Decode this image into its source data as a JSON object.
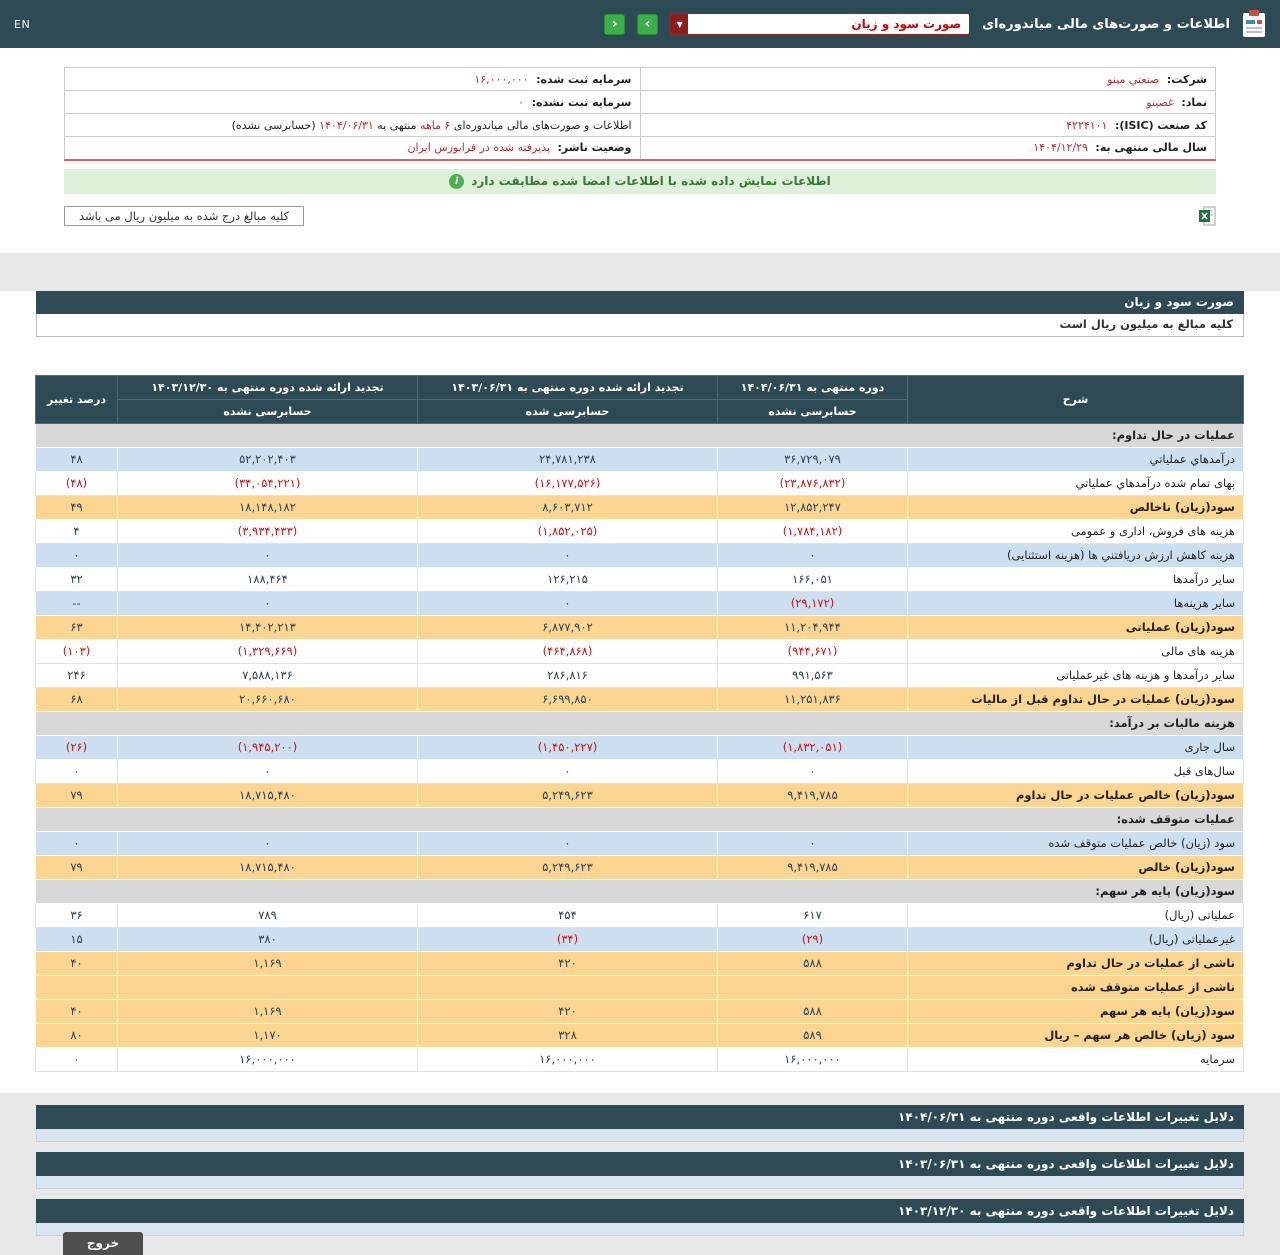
{
  "topbar": {
    "title": "اطلاعات و صورت‌های مالی میاندوره‌ای",
    "report_select": {
      "value": "صورت سود و زیان",
      "caret": "▼"
    },
    "nav_forward": "›",
    "nav_back": "‹",
    "lang_link": "EN"
  },
  "company_info": {
    "company_label": "شرکت:",
    "company_value": "صنعتي مينو",
    "symbol_label": "نماد:",
    "symbol_value": "غصينو",
    "isic_label": "کد صنعت (ISIC):",
    "isic_value": "۴۲۲۴۱۰۱",
    "fiscal_year_label": "سال مالی منتهی به:",
    "fiscal_year_value": "۱۴۰۴/۱۲/۲۹",
    "registered_capital_label": "سرمایه ثبت شده:",
    "registered_capital_value": "۱۶,۰۰۰,۰۰۰",
    "unregistered_capital_label": "سرمایه ثبت نشده:",
    "unregistered_capital_value": "۰",
    "period_line": {
      "p1": "اطلاعات و صورت‌های مالی میاندوره‌ای ",
      "p2": "۶ ماهه",
      "p3": " منتهی به ",
      "p4": "۱۴۰۴/۰۶/۳۱",
      "p5": " (حسابرسی نشده)"
    },
    "publisher_status_label": "وضعیت ناشر:",
    "publisher_status_value": "پذيرفته شده در فرابورس ايران"
  },
  "signature_banner": "اطلاعات نمایش داده شده با اطلاعات امضا شده مطابقت دارد",
  "amounts_note": "کلیه مبالغ درج شده به میلیون ریال می باشد",
  "statement": {
    "title": "صورت سود و زیان",
    "subtitle": "کلیه مبالغ به میلیون ریال است",
    "columns": {
      "desc": "شرح",
      "col1_period": "دوره منتهی به ۱۴۰۴/۰۶/۳۱",
      "col1_audit": "حسابرسی نشده",
      "col2_period": "تجدید ارائه شده دوره منتهی به ۱۴۰۳/۰۶/۳۱",
      "col2_audit": "حسابرسی شده",
      "col3_period": "تجدید ارائه شده دوره منتهی به ۱۴۰۳/۱۲/۳۰",
      "col3_audit": "حسابرسی نشده",
      "pct": "درصد تغییر"
    },
    "rows": [
      {
        "type": "section",
        "label": "عملیات در حال تداوم:",
        "style": "section"
      },
      {
        "type": "data",
        "label": "درآمدهاي عملياتي",
        "v1": "۳۶,۷۲۹,۰۷۹",
        "v2": "۲۴,۷۸۱,۲۳۸",
        "v3": "۵۲,۲۰۲,۴۰۳",
        "pct": "۴۸",
        "style": "blue"
      },
      {
        "type": "data",
        "label": "بهای تمام شده درآمدهاي عملياتي",
        "v1": "(۲۳,۸۷۶,۸۳۲)",
        "v2": "(۱۶,۱۷۷,۵۲۶)",
        "v3": "(۳۴,۰۵۴,۲۲۱)",
        "pct": "(۴۸)",
        "style": "white"
      },
      {
        "type": "data",
        "label": "سود(زیان) ناخالص",
        "v1": "۱۲,۸۵۲,۲۴۷",
        "v2": "۸,۶۰۳,۷۱۲",
        "v3": "۱۸,۱۴۸,۱۸۲",
        "pct": "۴۹",
        "style": "yellow"
      },
      {
        "type": "data",
        "label": "هزینه های فروش، اداری و عمومی",
        "v1": "(۱,۷۸۴,۱۸۲)",
        "v2": "(۱,۸۵۲,۰۲۵)",
        "v3": "(۳,۹۳۴,۴۳۳)",
        "pct": "۴",
        "style": "white"
      },
      {
        "type": "data",
        "label": "هزینه کاهش ارزش دریافتني ها (هزینه استثنایی)",
        "v1": "۰",
        "v2": "۰",
        "v3": "۰",
        "pct": "۰",
        "style": "blue"
      },
      {
        "type": "data",
        "label": "سایر درآمدها",
        "v1": "۱۶۶,۰۵۱",
        "v2": "۱۲۶,۲۱۵",
        "v3": "۱۸۸,۴۶۴",
        "pct": "۳۲",
        "style": "white"
      },
      {
        "type": "data",
        "label": "سایر هزینه‌ها",
        "v1": "(۲۹,۱۷۲)",
        "v2": "۰",
        "v3": "۰",
        "pct": "--",
        "style": "blue"
      },
      {
        "type": "data",
        "label": "سود(زیان) عملیاتی",
        "v1": "۱۱,۲۰۴,۹۴۴",
        "v2": "۶,۸۷۷,۹۰۲",
        "v3": "۱۴,۴۰۲,۲۱۳",
        "pct": "۶۳",
        "style": "yellow"
      },
      {
        "type": "data",
        "label": "هزینه های مالی",
        "v1": "(۹۴۴,۶۷۱)",
        "v2": "(۴۶۴,۸۶۸)",
        "v3": "(۱,۳۲۹,۶۶۹)",
        "pct": "(۱۰۳)",
        "style": "white"
      },
      {
        "type": "data",
        "label": "سایر درآمدها و هزینه های غیرعملیاتی",
        "v1": "۹۹۱,۵۶۳",
        "v2": "۲۸۶,۸۱۶",
        "v3": "۷,۵۸۸,۱۳۶",
        "pct": "۲۴۶",
        "style": "white"
      },
      {
        "type": "data",
        "label": "سود(زیان) عملیات در حال تداوم قبل از مالیات",
        "v1": "۱۱,۲۵۱,۸۳۶",
        "v2": "۶,۶۹۹,۸۵۰",
        "v3": "۲۰,۶۶۰,۶۸۰",
        "pct": "۶۸",
        "style": "yellow"
      },
      {
        "type": "section",
        "label": "هزینه مالیات بر درآمد:",
        "style": "section"
      },
      {
        "type": "data",
        "label": "سال جاری",
        "v1": "(۱,۸۳۲,۰۵۱)",
        "v2": "(۱,۴۵۰,۲۲۷)",
        "v3": "(۱,۹۴۵,۲۰۰)",
        "pct": "(۲۶)",
        "style": "blue"
      },
      {
        "type": "data",
        "label": "سال‌های قبل",
        "v1": "۰",
        "v2": "۰",
        "v3": "۰",
        "pct": "۰",
        "style": "white"
      },
      {
        "type": "data",
        "label": "سود(زیان) خالص عملیات در حال تداوم",
        "v1": "۹,۴۱۹,۷۸۵",
        "v2": "۵,۲۴۹,۶۲۳",
        "v3": "۱۸,۷۱۵,۴۸۰",
        "pct": "۷۹",
        "style": "yellow"
      },
      {
        "type": "section",
        "label": "عملیات متوقف شده:",
        "style": "section"
      },
      {
        "type": "data",
        "label": "سود (زیان) خالص عملیات متوقف شده",
        "v1": "۰",
        "v2": "۰",
        "v3": "۰",
        "pct": "۰",
        "style": "blue"
      },
      {
        "type": "data",
        "label": "سود(زیان) خالص",
        "v1": "۹,۴۱۹,۷۸۵",
        "v2": "۵,۲۴۹,۶۲۳",
        "v3": "۱۸,۷۱۵,۴۸۰",
        "pct": "۷۹",
        "style": "yellow"
      },
      {
        "type": "section",
        "label": "سود(زیان) پایه هر سهم:",
        "style": "section"
      },
      {
        "type": "data",
        "label": "عملیاتی (ریال)",
        "v1": "۶۱۷",
        "v2": "۴۵۴",
        "v3": "۷۸۹",
        "pct": "۳۶",
        "style": "white"
      },
      {
        "type": "data",
        "label": "غیرعملیاتی (ریال)",
        "v1": "(۲۹)",
        "v2": "(۳۴)",
        "v3": "۳۸۰",
        "pct": "۱۵",
        "style": "blue"
      },
      {
        "type": "data",
        "label": "ناشی از عملیات در حال تداوم",
        "v1": "۵۸۸",
        "v2": "۴۲۰",
        "v3": "۱,۱۶۹",
        "pct": "۴۰",
        "style": "yellow"
      },
      {
        "type": "data",
        "label": "ناشی از عملیات متوقف شده",
        "v1": "",
        "v2": "",
        "v3": "",
        "pct": "",
        "style": "yellow"
      },
      {
        "type": "data",
        "label": "سود(زیان) پایه هر سهم",
        "v1": "۵۸۸",
        "v2": "۴۲۰",
        "v3": "۱,۱۶۹",
        "pct": "۴۰",
        "style": "yellow"
      },
      {
        "type": "data",
        "label": "سود (زیان) خالص هر سهم – ریال",
        "v1": "۵۸۹",
        "v2": "۳۲۸",
        "v3": "۱,۱۷۰",
        "pct": "۸۰",
        "style": "yellow"
      },
      {
        "type": "data",
        "label": "سرمایه",
        "v1": "۱۶,۰۰۰,۰۰۰",
        "v2": "۱۶,۰۰۰,۰۰۰",
        "v3": "۱۶,۰۰۰,۰۰۰",
        "pct": "۰",
        "style": "white"
      }
    ]
  },
  "footnotes": [
    {
      "title": "دلایل تغییرات اطلاعات واقعی دوره منتهی به ۱۴۰۴/۰۶/۳۱"
    },
    {
      "title": "دلایل تغییرات اطلاعات واقعی دوره منتهی به ۱۴۰۳/۰۶/۳۱"
    },
    {
      "title": "دلایل تغییرات اطلاعات واقعی دوره منتهی به ۱۴۰۳/۱۲/۳۰"
    }
  ],
  "exit_button": "خروج",
  "colors": {
    "header_bg": "#2e4b55",
    "row_blue": "#cbdff1",
    "row_yellow": "#fcd690",
    "row_section": "#d8d8d8",
    "negative_text": "#cc1111",
    "info_value_red": "#bd2c2c",
    "banner_bg": "#ddf0d8",
    "banner_text": "#3c763d",
    "nav_green": "#3daf4a"
  }
}
